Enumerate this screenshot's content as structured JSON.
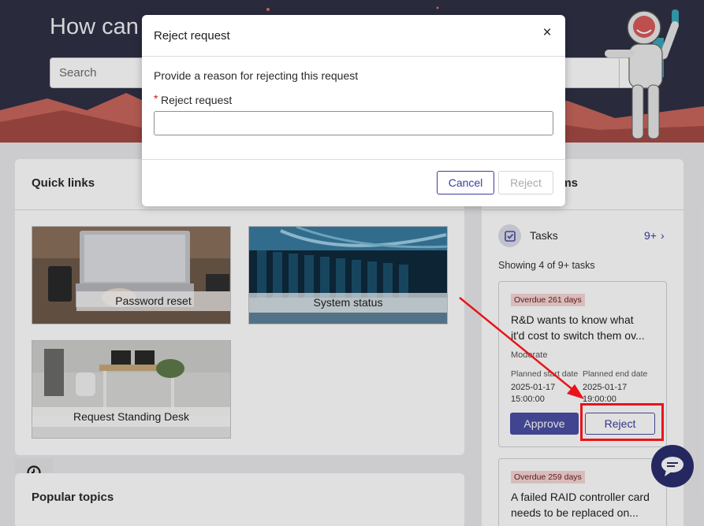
{
  "hero": {
    "title": "How can",
    "search_placeholder": "Search"
  },
  "quick_links": {
    "title": "Quick links",
    "tiles": [
      {
        "label": "Password reset"
      },
      {
        "label": "System status"
      },
      {
        "label": "Request Standing Desk"
      }
    ]
  },
  "popular_topics": {
    "title": "Popular topics"
  },
  "my_items": {
    "title": "ems",
    "tasks_label": "Tasks",
    "tasks_count": "9+",
    "showing": "Showing 4 of 9+ tasks",
    "cards": [
      {
        "overdue": "Overdue 261 days",
        "title_line1": "R&D wants to know what",
        "title_line2": "it'd cost to switch them ov...",
        "priority": "Moderate",
        "start_label": "Planned start date",
        "start_date": "2025-01-17",
        "start_time": "15:00:00",
        "end_label": "Planned end date",
        "end_date": "2025-01-17",
        "end_time": "19:00:00",
        "approve_label": "Approve",
        "reject_label": "Reject"
      },
      {
        "overdue": "Overdue 259 days",
        "title_line1": "A failed RAID controller card",
        "title_line2": "needs to be replaced on..."
      }
    ]
  },
  "modal": {
    "title": "Reject request",
    "close": "×",
    "description": "Provide a reason for rejecting this request",
    "required_mark": "*",
    "field_label": "Reject request",
    "field_value": "",
    "cancel_label": "Cancel",
    "reject_label": "Reject"
  },
  "colors": {
    "hero_bg": "#2f3045",
    "accent": "#4b4ea3",
    "annotation": "#e8141a"
  },
  "icons": {
    "search": "search-icon",
    "close": "close-icon",
    "tasks": "tasks-check-icon",
    "chevron": "chevron-right-icon",
    "history": "history-clock-icon",
    "chat": "chat-bubble-icon"
  }
}
